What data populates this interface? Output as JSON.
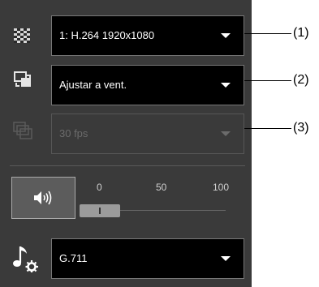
{
  "controls": {
    "stream": {
      "icon": "checkerboard-icon",
      "value": "1: H.264 1920x1080"
    },
    "display": {
      "icon": "resize-window-icon",
      "value": "Ajustar a vent."
    },
    "framerate": {
      "icon": "stacked-windows-icon",
      "value": "30 fps",
      "disabled": true
    },
    "volume": {
      "icon": "speaker-icon",
      "ticks": [
        "0",
        "50",
        "100"
      ],
      "level": 0
    },
    "audio_codec": {
      "icon": "music-note-gear-icon",
      "value": "G.711"
    }
  },
  "callouts": [
    "(1)",
    "(2)",
    "(3)"
  ],
  "colors": {
    "panel": "#3a3a3a",
    "dropdown": "#000000",
    "text": "#ffffff",
    "disabled_text": "#6b6b6b"
  }
}
